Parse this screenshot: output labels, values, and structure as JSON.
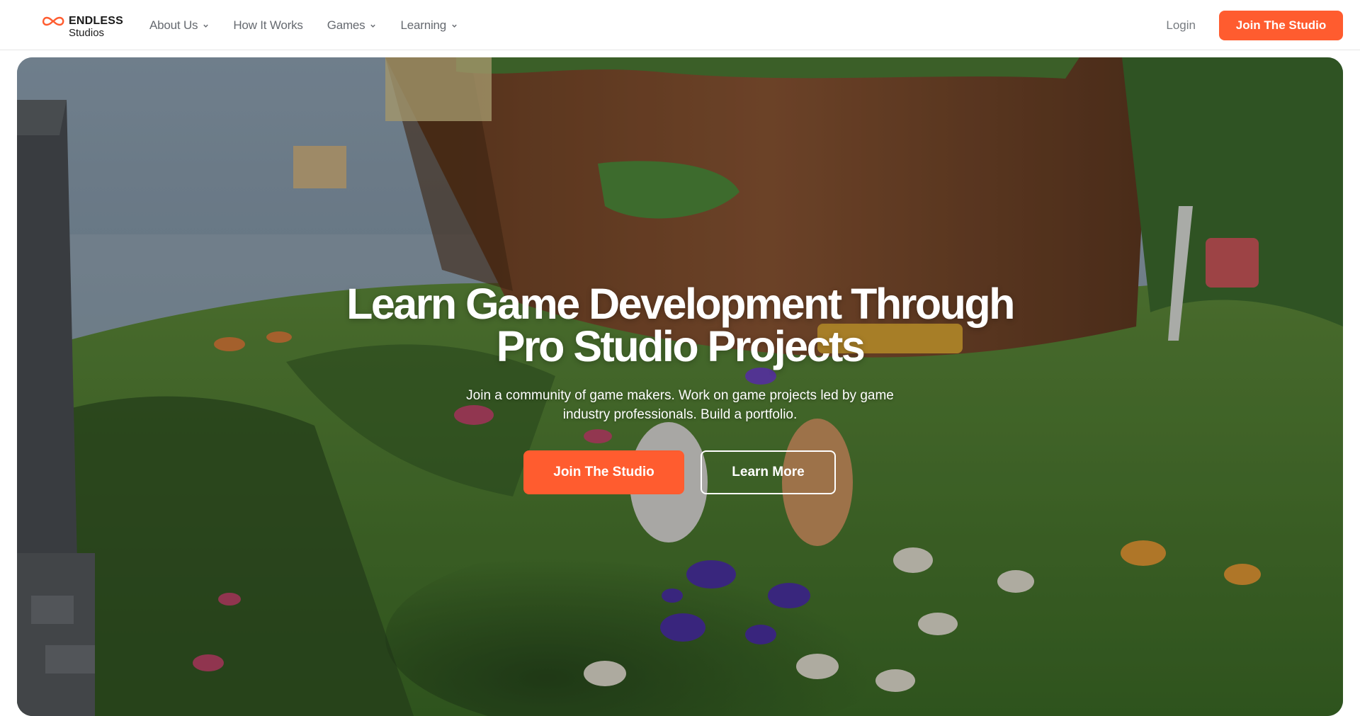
{
  "brand": {
    "name_line1": "ENDLESS",
    "name_line2": "Studios",
    "accent_color": "#ff5c2f",
    "logo_icon": "infinity-icon"
  },
  "nav": {
    "items": [
      {
        "label": "About Us",
        "has_dropdown": true
      },
      {
        "label": "How It Works",
        "has_dropdown": false
      },
      {
        "label": "Games",
        "has_dropdown": true
      },
      {
        "label": "Learning",
        "has_dropdown": true
      }
    ],
    "login_label": "Login",
    "cta_label": "Join The Studio"
  },
  "hero": {
    "title": "Learn Game Development  Through\nPro Studio Projects",
    "subtitle": "Join a community of game makers. Work on game projects led by game industry professionals. Build a portfolio.",
    "primary_button": "Join The Studio",
    "secondary_button": "Learn More",
    "background": "game-screenshot-grass-island-scene"
  }
}
